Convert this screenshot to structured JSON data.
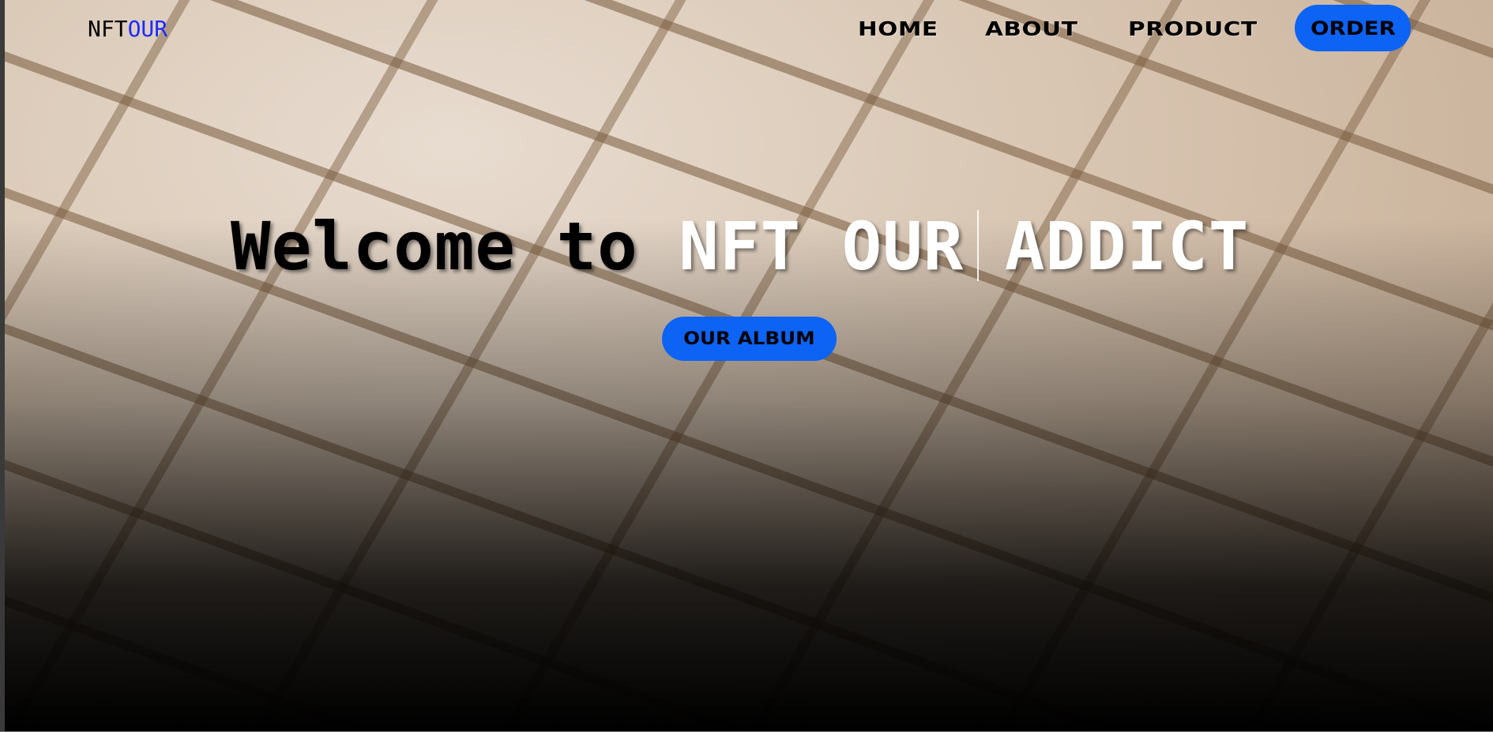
{
  "brand": {
    "logo_part1": "NFT",
    "logo_part2": "OUR"
  },
  "nav": {
    "home": "HOME",
    "about": "ABOUT",
    "product": "PRODUCT",
    "order": "ORDER"
  },
  "hero": {
    "headline_dark": "Welcome to ",
    "headline_light": "NFT OUR ADDICT",
    "album_button": "OUR ALBUM"
  },
  "colors": {
    "accent": "#0d63f4",
    "logo_accent": "#1c2bff"
  }
}
